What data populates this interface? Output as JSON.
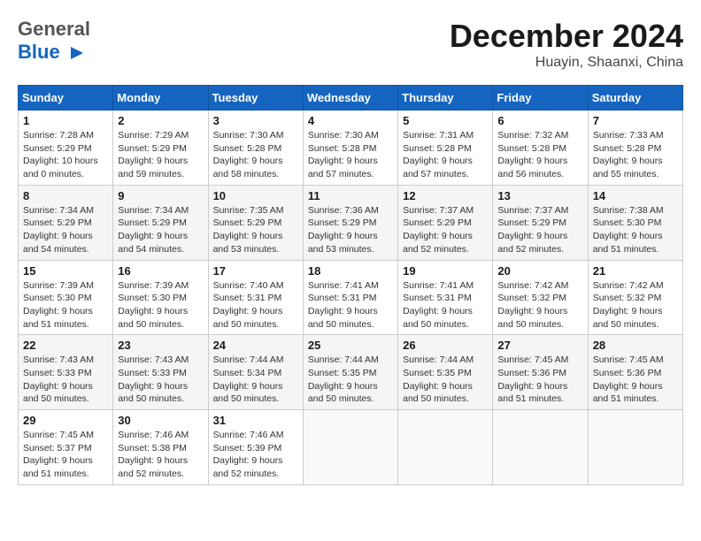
{
  "header": {
    "logo_general": "General",
    "logo_blue": "Blue",
    "title": "December 2024",
    "subtitle": "Huayin, Shaanxi, China"
  },
  "calendar": {
    "month": "December 2024",
    "location": "Huayin, Shaanxi, China",
    "weekdays": [
      "Sunday",
      "Monday",
      "Tuesday",
      "Wednesday",
      "Thursday",
      "Friday",
      "Saturday"
    ],
    "weeks": [
      [
        {
          "day": "1",
          "sunrise": "7:28 AM",
          "sunset": "5:29 PM",
          "daylight": "10 hours and 0 minutes"
        },
        {
          "day": "2",
          "sunrise": "7:29 AM",
          "sunset": "5:29 PM",
          "daylight": "9 hours and 59 minutes"
        },
        {
          "day": "3",
          "sunrise": "7:30 AM",
          "sunset": "5:28 PM",
          "daylight": "9 hours and 58 minutes"
        },
        {
          "day": "4",
          "sunrise": "7:30 AM",
          "sunset": "5:28 PM",
          "daylight": "9 hours and 57 minutes"
        },
        {
          "day": "5",
          "sunrise": "7:31 AM",
          "sunset": "5:28 PM",
          "daylight": "9 hours and 57 minutes"
        },
        {
          "day": "6",
          "sunrise": "7:32 AM",
          "sunset": "5:28 PM",
          "daylight": "9 hours and 56 minutes"
        },
        {
          "day": "7",
          "sunrise": "7:33 AM",
          "sunset": "5:28 PM",
          "daylight": "9 hours and 55 minutes"
        }
      ],
      [
        {
          "day": "8",
          "sunrise": "7:34 AM",
          "sunset": "5:29 PM",
          "daylight": "9 hours and 54 minutes"
        },
        {
          "day": "9",
          "sunrise": "7:34 AM",
          "sunset": "5:29 PM",
          "daylight": "9 hours and 54 minutes"
        },
        {
          "day": "10",
          "sunrise": "7:35 AM",
          "sunset": "5:29 PM",
          "daylight": "9 hours and 53 minutes"
        },
        {
          "day": "11",
          "sunrise": "7:36 AM",
          "sunset": "5:29 PM",
          "daylight": "9 hours and 53 minutes"
        },
        {
          "day": "12",
          "sunrise": "7:37 AM",
          "sunset": "5:29 PM",
          "daylight": "9 hours and 52 minutes"
        },
        {
          "day": "13",
          "sunrise": "7:37 AM",
          "sunset": "5:29 PM",
          "daylight": "9 hours and 52 minutes"
        },
        {
          "day": "14",
          "sunrise": "7:38 AM",
          "sunset": "5:30 PM",
          "daylight": "9 hours and 51 minutes"
        }
      ],
      [
        {
          "day": "15",
          "sunrise": "7:39 AM",
          "sunset": "5:30 PM",
          "daylight": "9 hours and 51 minutes"
        },
        {
          "day": "16",
          "sunrise": "7:39 AM",
          "sunset": "5:30 PM",
          "daylight": "9 hours and 50 minutes"
        },
        {
          "day": "17",
          "sunrise": "7:40 AM",
          "sunset": "5:31 PM",
          "daylight": "9 hours and 50 minutes"
        },
        {
          "day": "18",
          "sunrise": "7:41 AM",
          "sunset": "5:31 PM",
          "daylight": "9 hours and 50 minutes"
        },
        {
          "day": "19",
          "sunrise": "7:41 AM",
          "sunset": "5:31 PM",
          "daylight": "9 hours and 50 minutes"
        },
        {
          "day": "20",
          "sunrise": "7:42 AM",
          "sunset": "5:32 PM",
          "daylight": "9 hours and 50 minutes"
        },
        {
          "day": "21",
          "sunrise": "7:42 AM",
          "sunset": "5:32 PM",
          "daylight": "9 hours and 50 minutes"
        }
      ],
      [
        {
          "day": "22",
          "sunrise": "7:43 AM",
          "sunset": "5:33 PM",
          "daylight": "9 hours and 50 minutes"
        },
        {
          "day": "23",
          "sunrise": "7:43 AM",
          "sunset": "5:33 PM",
          "daylight": "9 hours and 50 minutes"
        },
        {
          "day": "24",
          "sunrise": "7:44 AM",
          "sunset": "5:34 PM",
          "daylight": "9 hours and 50 minutes"
        },
        {
          "day": "25",
          "sunrise": "7:44 AM",
          "sunset": "5:35 PM",
          "daylight": "9 hours and 50 minutes"
        },
        {
          "day": "26",
          "sunrise": "7:44 AM",
          "sunset": "5:35 PM",
          "daylight": "9 hours and 50 minutes"
        },
        {
          "day": "27",
          "sunrise": "7:45 AM",
          "sunset": "5:36 PM",
          "daylight": "9 hours and 51 minutes"
        },
        {
          "day": "28",
          "sunrise": "7:45 AM",
          "sunset": "5:36 PM",
          "daylight": "9 hours and 51 minutes"
        }
      ],
      [
        {
          "day": "29",
          "sunrise": "7:45 AM",
          "sunset": "5:37 PM",
          "daylight": "9 hours and 51 minutes"
        },
        {
          "day": "30",
          "sunrise": "7:46 AM",
          "sunset": "5:38 PM",
          "daylight": "9 hours and 52 minutes"
        },
        {
          "day": "31",
          "sunrise": "7:46 AM",
          "sunset": "5:39 PM",
          "daylight": "9 hours and 52 minutes"
        },
        null,
        null,
        null,
        null
      ]
    ]
  }
}
